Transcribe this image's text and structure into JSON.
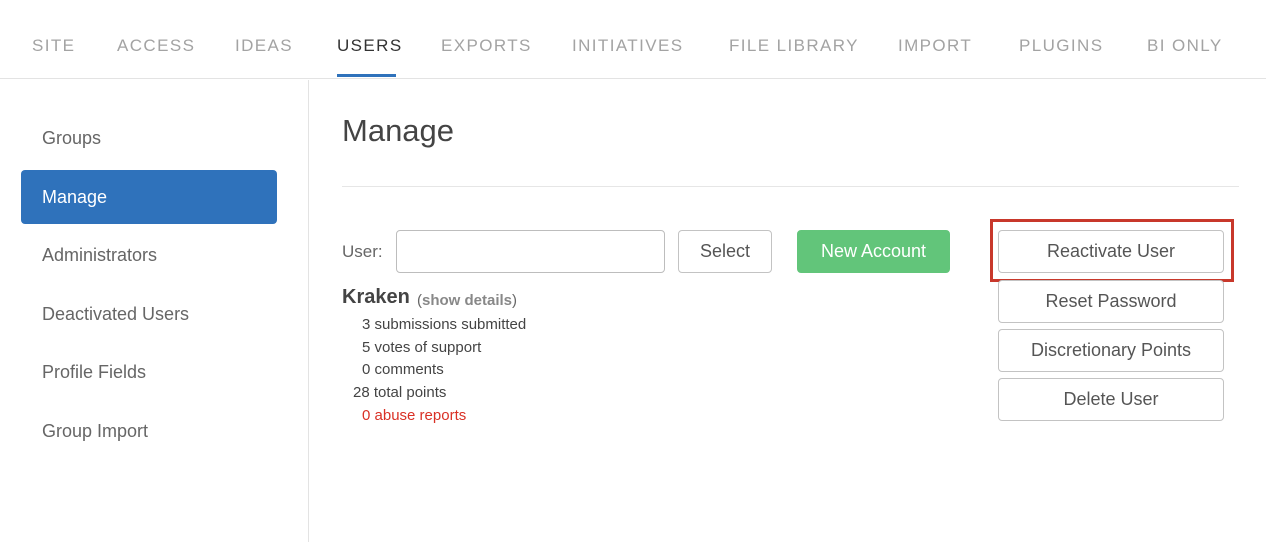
{
  "topnav": {
    "tabs": [
      {
        "label": "SITE",
        "active": false
      },
      {
        "label": "ACCESS",
        "active": false
      },
      {
        "label": "IDEAS",
        "active": false
      },
      {
        "label": "USERS",
        "active": true
      },
      {
        "label": "EXPORTS",
        "active": false
      },
      {
        "label": "INITIATIVES",
        "active": false
      },
      {
        "label": "FILE LIBRARY",
        "active": false
      },
      {
        "label": "IMPORT",
        "active": false
      },
      {
        "label": "PLUGINS",
        "active": false
      },
      {
        "label": "BI ONLY",
        "active": false
      }
    ]
  },
  "sidebar": {
    "items": [
      {
        "label": "Groups",
        "active": false
      },
      {
        "label": "Manage",
        "active": true
      },
      {
        "label": "Administrators",
        "active": false
      },
      {
        "label": "Deactivated Users",
        "active": false
      },
      {
        "label": "Profile Fields",
        "active": false
      },
      {
        "label": "Group Import",
        "active": false
      }
    ]
  },
  "main": {
    "title": "Manage",
    "user_label": "User:",
    "user_input": {
      "value": "",
      "placeholder": ""
    },
    "select_label": "Select",
    "new_account_label": "New Account",
    "user": {
      "name": "Kraken",
      "show_details_open": "(",
      "show_details_label": "show details",
      "show_details_close": ")",
      "stats": {
        "submissions": "3 submissions submitted",
        "votes": "5 votes of support",
        "comments": "0 comments",
        "total_points": "28 total points",
        "abuse_reports": "0 abuse reports"
      }
    },
    "actions": {
      "reactivate": "Reactivate User",
      "reset_password": "Reset Password",
      "discretionary_points": "Discretionary Points",
      "delete": "Delete User"
    }
  },
  "colors": {
    "accent": "#2f72bb",
    "success": "#62c57a",
    "danger": "#d93025",
    "highlight_box": "#c8382b"
  }
}
